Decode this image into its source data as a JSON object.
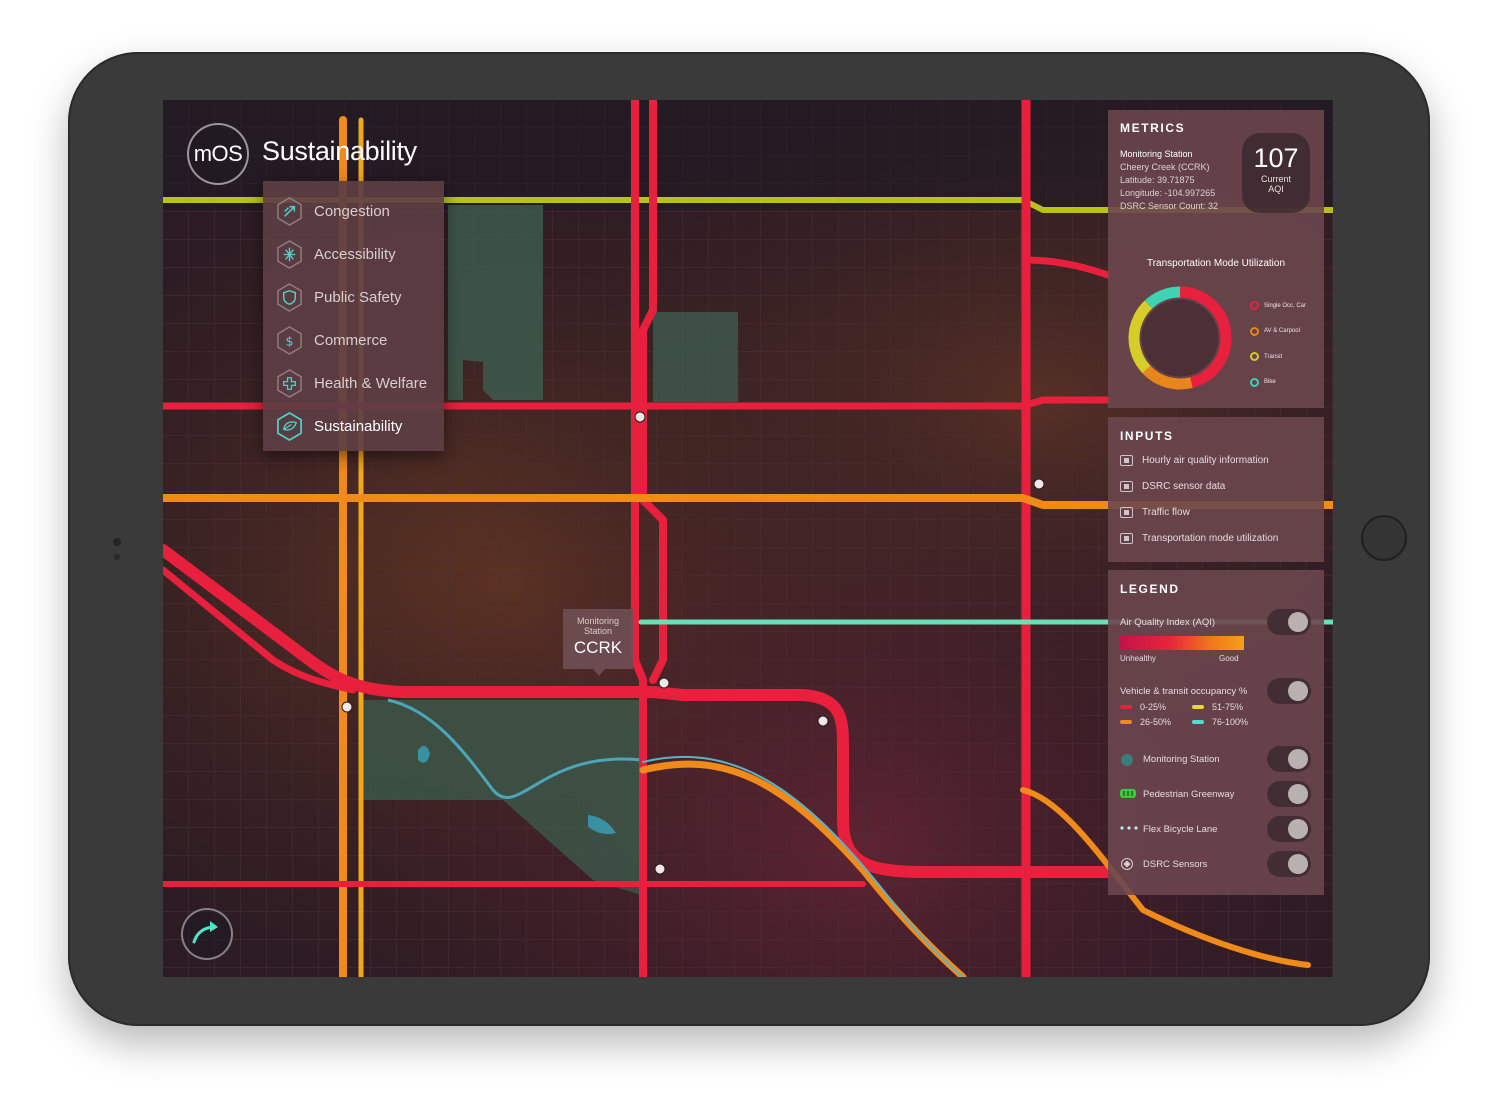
{
  "app": {
    "logo": "mOS",
    "title": "Sustainability"
  },
  "menu": {
    "items": [
      {
        "label": "Congestion",
        "icon": "congestion-icon"
      },
      {
        "label": "Accessibility",
        "icon": "accessibility-icon"
      },
      {
        "label": "Public Safety",
        "icon": "shield-icon"
      },
      {
        "label": "Commerce",
        "icon": "dollar-icon"
      },
      {
        "label": "Health & Welfare",
        "icon": "health-cross-icon"
      },
      {
        "label": "Sustainability",
        "icon": "leaf-icon",
        "active": true
      }
    ]
  },
  "map": {
    "station_callout": {
      "line1": "Monitoring",
      "line2": "Station",
      "code": "CCRK"
    }
  },
  "metrics": {
    "title": "METRICS",
    "station_heading": "Monitoring Station",
    "station_name": "Cheery Creek (CCRK)",
    "latitude": "Latitude: 39.71875",
    "longitude": "Longitude: -104.997265",
    "sensor_count": "DSRC Sensor Count: 32",
    "aqi_value": "107",
    "aqi_label_1": "Current",
    "aqi_label_2": "AQI",
    "chart_title": "Transportation Mode Utilization"
  },
  "chart_data": {
    "type": "pie",
    "title": "Transportation Mode Utilization",
    "categories": [
      "Single Occ. Car",
      "AV & Carpool",
      "Transit",
      "Bike"
    ],
    "values": [
      46,
      17,
      25,
      12
    ],
    "colors": [
      "#e8203d",
      "#e8861c",
      "#d6cc2a",
      "#3ed3b2"
    ]
  },
  "inputs": {
    "title": "INPUTS",
    "items": [
      "Hourly air quality information",
      "DSRC sensor data",
      "Traffic flow",
      "Transportation mode utilization"
    ]
  },
  "legend": {
    "title": "LEGEND",
    "aqi_label": "Air Quality Index (AQI)",
    "aqi_low": "Unhealthy",
    "aqi_high": "Good",
    "occupancy_label": "Vehicle & transit occupancy %",
    "occupancy": [
      {
        "label": "0-25%",
        "color": "#e8203d"
      },
      {
        "label": "51-75%",
        "color": "#e6dc2a"
      },
      {
        "label": "26-50%",
        "color": "#f08a1a"
      },
      {
        "label": "76-100%",
        "color": "#49e0d0"
      }
    ],
    "layers": [
      {
        "label": "Monitoring Station",
        "icon": "station-dot-icon"
      },
      {
        "label": "Pedestrian Greenway",
        "icon": "greenway-icon"
      },
      {
        "label": "Flex Bicycle Lane",
        "icon": "bike-lane-icon"
      },
      {
        "label": "DSRC Sensors",
        "icon": "sensor-diamond-icon"
      }
    ]
  }
}
